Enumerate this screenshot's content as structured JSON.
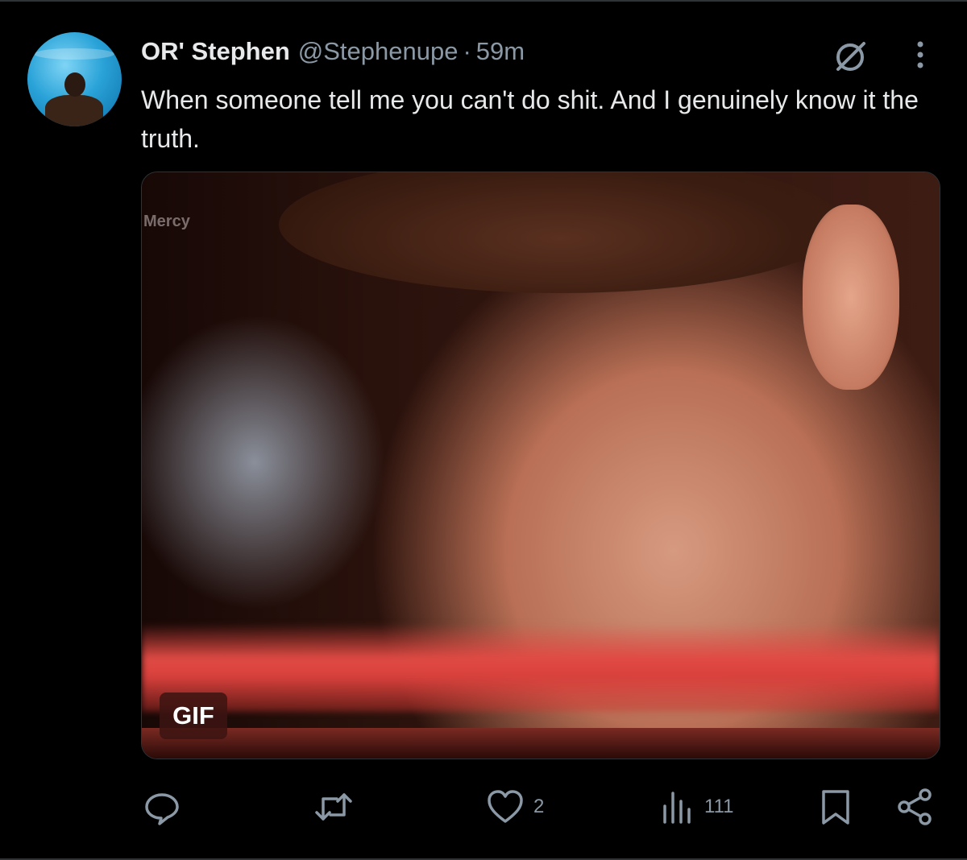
{
  "tweet": {
    "author_name": "OR' Stephen",
    "author_handle": "@Stephenupe",
    "separator": "·",
    "time": "59m",
    "text": "When someone tell me you can't do shit. And I genuinely know it the truth.",
    "media": {
      "watermark": "Mercy",
      "badge": "GIF"
    }
  },
  "icons": {
    "grok": "grok-icon",
    "more": "more-icon",
    "reply": "reply-icon",
    "retweet": "retweet-icon",
    "like": "heart-icon",
    "views": "views-icon",
    "bookmark": "bookmark-icon",
    "share": "share-icon"
  },
  "actions": {
    "reply_count": "",
    "retweet_count": "",
    "like_count": "2",
    "view_count": "111"
  },
  "colors": {
    "background": "#000000",
    "text": "#e7e9ea",
    "secondary": "#8b98a5"
  }
}
